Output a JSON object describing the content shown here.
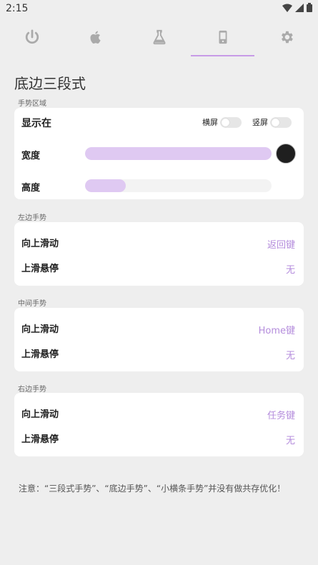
{
  "status": {
    "time": "2:15"
  },
  "tabs": [
    {
      "icon": "power-icon"
    },
    {
      "icon": "apple-icon"
    },
    {
      "icon": "flask-icon"
    },
    {
      "icon": "phone-icon",
      "active": true
    },
    {
      "icon": "gear-icon"
    }
  ],
  "page": {
    "title": "底边三段式"
  },
  "gesture_area": {
    "section": "手势区域",
    "show_on": "显示在",
    "landscape": "横屏",
    "portrait": "竖屏",
    "width_label": "宽度",
    "height_label": "高度",
    "width_level": 1.0,
    "height_level": 0.22,
    "color": "#1f1f1f"
  },
  "left": {
    "section": "左边手势",
    "swipe_up": "向上滑动",
    "swipe_up_value": "返回键",
    "hover": "上滑悬停",
    "hover_value": "无"
  },
  "middle": {
    "section": "中间手势",
    "swipe_up": "向上滑动",
    "swipe_up_value": "Home键",
    "hover": "上滑悬停",
    "hover_value": "无"
  },
  "right": {
    "section": "右边手势",
    "swipe_up": "向上滑动",
    "swipe_up_value": "任务键",
    "hover": "上滑悬停",
    "hover_value": "无"
  },
  "note": "注意：“三段式手势”、“底边手势”、“小横条手势”并没有做共存优化！",
  "colors": {
    "accent": "#b48cdc",
    "slider_fill": "#dfc9f2",
    "background": "#eeeeee"
  }
}
